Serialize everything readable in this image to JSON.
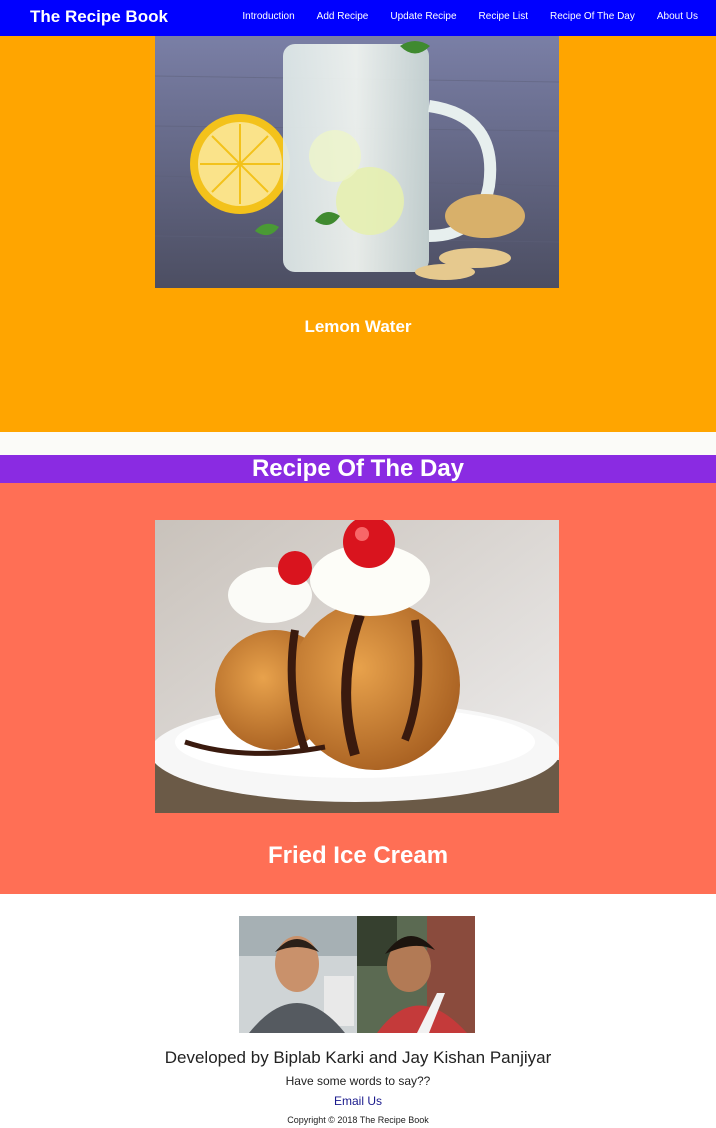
{
  "navbar": {
    "brand": "The Recipe Book",
    "links": [
      {
        "label": "Introduction"
      },
      {
        "label": "Add Recipe"
      },
      {
        "label": "Update Recipe"
      },
      {
        "label": "Recipe List"
      },
      {
        "label": "Recipe Of The Day"
      },
      {
        "label": "About Us"
      }
    ]
  },
  "recipes": {
    "top": {
      "name": "Lemon Water"
    },
    "of_the_day": {
      "heading": "Recipe Of The Day",
      "name": "Fried Ice Cream"
    }
  },
  "footer": {
    "developed_by": "Developed by Biplab Karki and Jay Kishan Panjiyar",
    "prompt": "Have some words to say??",
    "email_label": "Email Us",
    "copyright": "Copyright © 2018 The Recipe Book"
  },
  "colors": {
    "navbar": "#0000ff",
    "top_section": "#ffa500",
    "rotd_header": "#8a2be2",
    "rotd_section": "#ff6f55"
  }
}
